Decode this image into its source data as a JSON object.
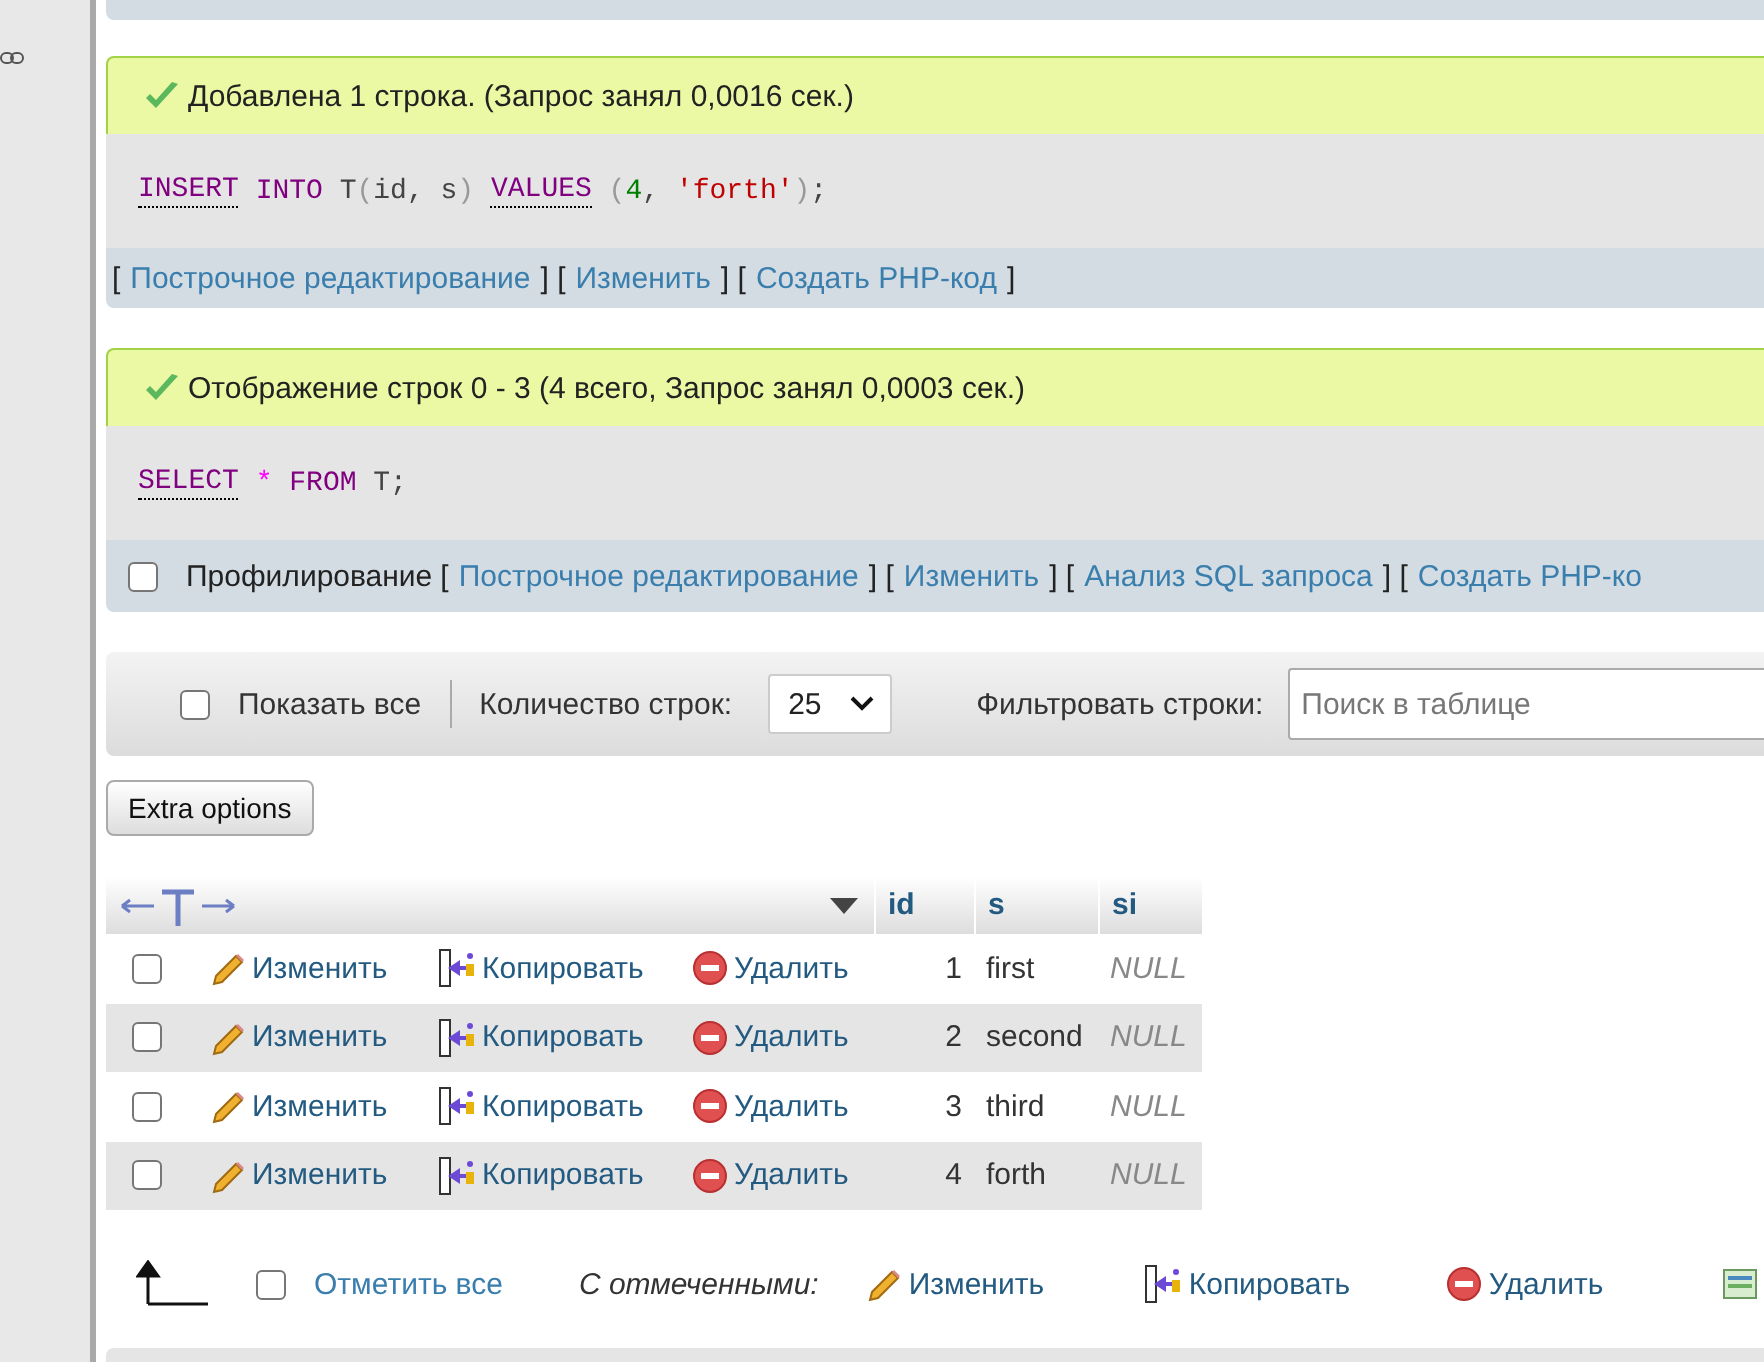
{
  "messages": [
    {
      "kind": "success",
      "text": "Добавлена 1 строка. (Запрос занял 0,0016 сек.)",
      "sql": [
        {
          "kind": "keyword",
          "text": "INSERT"
        },
        {
          "kind": "keyword_plain",
          "text": " INTO"
        },
        {
          "kind": "plain",
          "text": " T"
        },
        {
          "kind": "punct",
          "text": "("
        },
        {
          "kind": "plain",
          "text": "id, s"
        },
        {
          "kind": "punct",
          "text": ") "
        },
        {
          "kind": "keyword",
          "text": "VALUES"
        },
        {
          "kind": "punct",
          "text": " ("
        },
        {
          "kind": "number",
          "text": "4"
        },
        {
          "kind": "plain",
          "text": ", "
        },
        {
          "kind": "string",
          "text": "'forth'"
        },
        {
          "kind": "punct",
          "text": ")"
        },
        {
          "kind": "plain",
          "text": ";"
        }
      ],
      "links": [
        {
          "kind": "text",
          "text": "["
        },
        {
          "kind": "link",
          "text": "Построчное редактирование"
        },
        {
          "kind": "text",
          "text": "] ["
        },
        {
          "kind": "link",
          "text": "Изменить"
        },
        {
          "kind": "text",
          "text": "] ["
        },
        {
          "kind": "link",
          "text": "Создать PHP-код"
        },
        {
          "kind": "text",
          "text": "]"
        }
      ]
    },
    {
      "kind": "success",
      "text": "Отображение строк 0 - 3 (4 всего, Запрос занял 0,0003 сек.)",
      "sql": [
        {
          "kind": "keyword",
          "text": "SELECT"
        },
        {
          "kind": "operator",
          "text": " *"
        },
        {
          "kind": "keyword_plain",
          "text": " FROM"
        },
        {
          "kind": "plain",
          "text": " T;"
        }
      ],
      "profiling": {
        "label": "Профилирование",
        "checked": false
      },
      "links": [
        {
          "kind": "text",
          "text": "["
        },
        {
          "kind": "link",
          "text": "Построчное редактирование"
        },
        {
          "kind": "text",
          "text": "] ["
        },
        {
          "kind": "link",
          "text": "Изменить"
        },
        {
          "kind": "text",
          "text": "] ["
        },
        {
          "kind": "link",
          "text": "Анализ SQL запроса"
        },
        {
          "kind": "text",
          "text": "] ["
        },
        {
          "kind": "link",
          "text": "Создать PHP-ко"
        }
      ]
    }
  ],
  "toolbar": {
    "show_all": {
      "label": "Показать все",
      "checked": false
    },
    "rows_label": "Количество строк:",
    "rows_value": "25",
    "filter_label": "Фильтровать строки:",
    "filter_placeholder": "Поиск в таблице"
  },
  "extra_options": "Extra options",
  "table": {
    "columns": [
      "id",
      "s",
      "si"
    ],
    "rows": [
      {
        "checked": false,
        "edit": "Изменить",
        "copy": "Копировать",
        "delete": "Удалить",
        "id": "1",
        "s": "first",
        "si": "NULL"
      },
      {
        "checked": false,
        "edit": "Изменить",
        "copy": "Копировать",
        "delete": "Удалить",
        "id": "2",
        "s": "second",
        "si": "NULL"
      },
      {
        "checked": false,
        "edit": "Изменить",
        "copy": "Копировать",
        "delete": "Удалить",
        "id": "3",
        "s": "third",
        "si": "NULL"
      },
      {
        "checked": false,
        "edit": "Изменить",
        "copy": "Копировать",
        "delete": "Удалить",
        "id": "4",
        "s": "forth",
        "si": "NULL"
      }
    ]
  },
  "bulk": {
    "check_all": {
      "label": "Отметить все",
      "checked": false
    },
    "with_selected": "С отмеченными:",
    "actions": [
      {
        "kind": "edit",
        "label": "Изменить"
      },
      {
        "kind": "copy",
        "label": "Копировать"
      },
      {
        "kind": "delete",
        "label": "Удалить"
      },
      {
        "kind": "export"
      }
    ]
  }
}
